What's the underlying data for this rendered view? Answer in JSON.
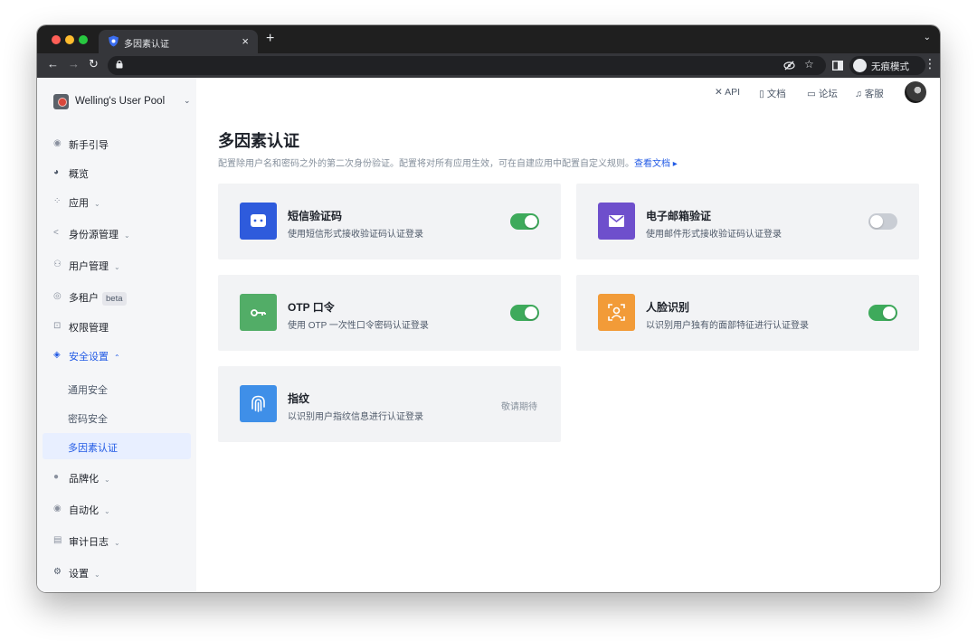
{
  "browser": {
    "tab_title": "多因素认证",
    "new_tab_label": "+",
    "incognito_label": "无痕模式"
  },
  "sidebar": {
    "pool_name": "Welling's User Pool",
    "items": [
      {
        "label": "新手引导",
        "icon": "compass-icon",
        "has_caret": false
      },
      {
        "label": "概览",
        "icon": "pie-chart-icon",
        "has_caret": false
      },
      {
        "label": "应用",
        "icon": "apps-grid-icon",
        "has_caret": true
      },
      {
        "label": "身份源管理",
        "icon": "share-icon",
        "has_caret": true
      },
      {
        "label": "用户管理",
        "icon": "users-icon",
        "has_caret": true
      },
      {
        "label": "多租户",
        "icon": "tenant-icon",
        "has_caret": false,
        "badge": "beta"
      },
      {
        "label": "权限管理",
        "icon": "lock-icon",
        "has_caret": false
      },
      {
        "label": "安全设置",
        "icon": "shield-icon",
        "has_caret": true,
        "expanded": true
      },
      {
        "label": "品牌化",
        "icon": "planet-icon",
        "has_caret": true
      },
      {
        "label": "自动化",
        "icon": "automation-icon",
        "has_caret": true
      },
      {
        "label": "审计日志",
        "icon": "log-icon",
        "has_caret": true
      },
      {
        "label": "设置",
        "icon": "gear-icon",
        "has_caret": true
      }
    ],
    "security_subitems": [
      "通用安全",
      "密码安全",
      "多因素认证"
    ],
    "active_subitem": "多因素认证"
  },
  "topnav": {
    "api": "API",
    "docs": "文档",
    "forum": "论坛",
    "support": "客服"
  },
  "page": {
    "title": "多因素认证",
    "description": "配置除用户名和密码之外的第二次身份验证。配置将对所有应用生效，可在自建应用中配置自定义规则。",
    "link": "查看文档"
  },
  "cards": [
    {
      "title": "短信验证码",
      "desc": "使用短信形式接收验证码认证登录",
      "icon": "sms-icon",
      "color": "#2e5bdc",
      "enabled": true
    },
    {
      "title": "电子邮箱验证",
      "desc": "使用邮件形式接收验证码认证登录",
      "icon": "email-icon",
      "color": "#6e4fcc",
      "enabled": false
    },
    {
      "title": "OTP 口令",
      "desc": "使用 OTP 一次性口令密码认证登录",
      "icon": "key-icon",
      "color": "#52ad67",
      "enabled": true
    },
    {
      "title": "人脸识别",
      "desc": "以识别用户独有的面部特征进行认证登录",
      "icon": "face-scan-icon",
      "color": "#f29b38",
      "enabled": true
    },
    {
      "title": "指纹",
      "desc": "以识别用户指纹信息进行认证登录",
      "icon": "fingerprint-icon",
      "color": "#3f8fe8",
      "status": "敬请期待"
    }
  ],
  "colors": {
    "accent": "#215ae5",
    "toggle_on": "#3eaa5b",
    "toggle_off": "#c9cdd4"
  }
}
